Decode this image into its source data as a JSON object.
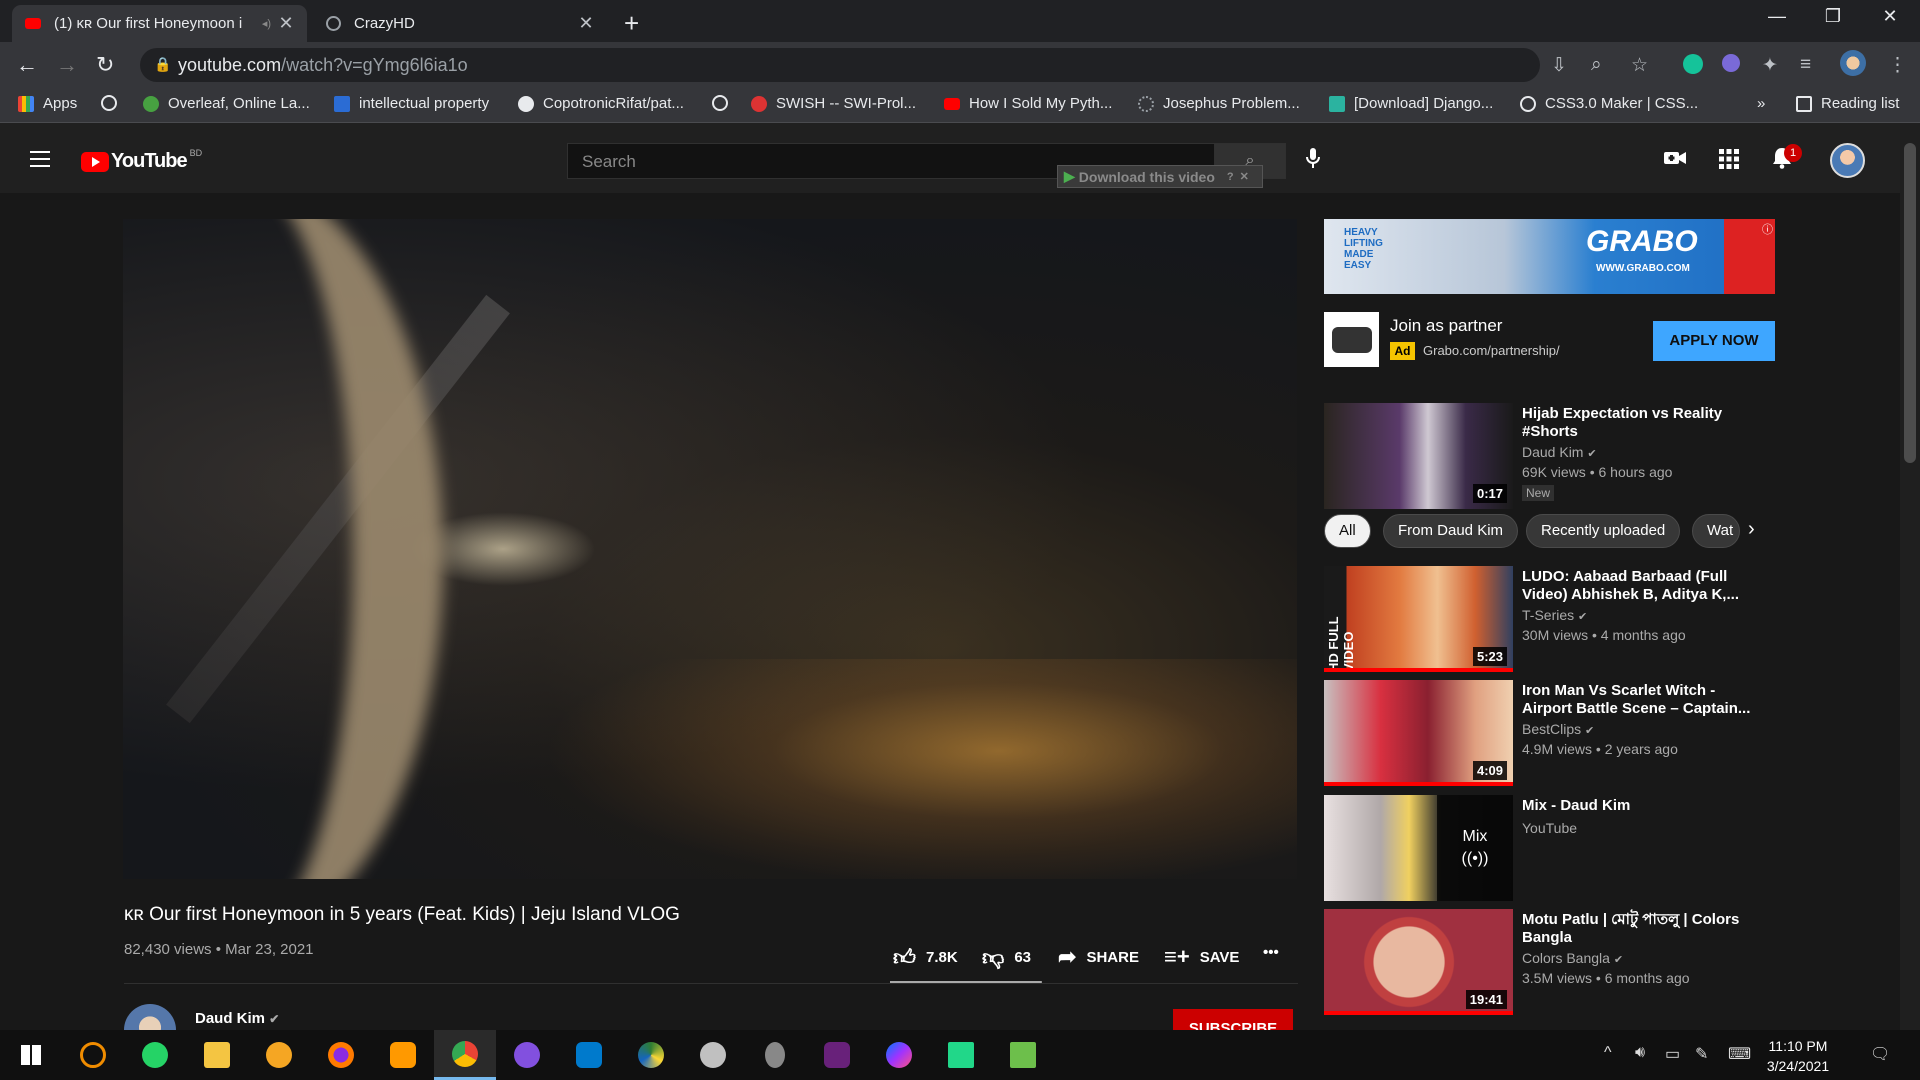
{
  "browser": {
    "tabs": [
      {
        "title": "(1) ᴋʀ Our first Honeymoon i",
        "active": true
      },
      {
        "title": "CrazyHD",
        "active": false
      }
    ],
    "url_host": "youtube.com",
    "url_path": "/watch?v=gYmg6l6ia1o",
    "bookmarks": [
      {
        "label": "Apps"
      },
      {
        "label": ""
      },
      {
        "label": "Overleaf, Online La..."
      },
      {
        "label": "intellectual property"
      },
      {
        "label": "CopotronicRifat/pat..."
      },
      {
        "label": ""
      },
      {
        "label": "SWISH -- SWI-Prol..."
      },
      {
        "label": "How I Sold My Pyth..."
      },
      {
        "label": "Josephus Problem..."
      },
      {
        "label": "[Download] Django..."
      },
      {
        "label": "CSS3.0 Maker | CSS..."
      }
    ],
    "bookmarks_overflow": "»",
    "reading_list": "Reading list"
  },
  "youtube": {
    "logo_text": "YouTube",
    "country": "BD",
    "search_placeholder": "Search",
    "download_bar": "Download this video",
    "notification_count": "1",
    "video": {
      "title": "ᴋʀ Our first Honeymoon in 5 years (Feat. Kids) | Jeju Island VLOG",
      "views": "82,430 views • Mar 23, 2021",
      "likes": "7.8K",
      "dislikes": "63",
      "like_ratio": 0.992,
      "share": "SHARE",
      "save": "SAVE",
      "more": "•••"
    },
    "channel": {
      "name": "Daud Kim",
      "subscribe": "SUBSCRIBE"
    },
    "ad": {
      "banner_brand": "GRABO",
      "banner_tagline": "HEAVY LIFTING MADE EASY",
      "banner_url": "WWW.GRABO.COM",
      "title": "Join as partner",
      "badge": "Ad",
      "url": "Grabo.com/partnership/",
      "cta": "APPLY NOW"
    },
    "chips": [
      "All",
      "From Daud Kim",
      "Recently uploaded",
      "Wat"
    ],
    "recommendations": [
      {
        "title": "Hijab Expectation vs Reality #Shorts",
        "channel": "Daud Kim",
        "verified": true,
        "meta": "69K views • 6 hours ago",
        "badge": "New",
        "duration": "0:17",
        "watched": 0
      },
      {
        "title": "LUDO: Aabaad Barbaad (Full Video) Abhishek B, Aditya K,...",
        "channel": "T-Series",
        "verified": true,
        "meta": "30M views • 4 months ago",
        "badge": "",
        "duration": "5:23",
        "watched": 1.0
      },
      {
        "title": "Iron Man Vs Scarlet Witch - Airport Battle Scene – Captain...",
        "channel": "BestClips",
        "verified": true,
        "meta": "4.9M views • 2 years ago",
        "badge": "",
        "duration": "4:09",
        "watched": 1.0
      },
      {
        "title": "Mix - Daud Kim",
        "channel": "YouTube",
        "verified": false,
        "meta": "",
        "badge": "",
        "duration": "",
        "mix_label": "Mix",
        "watched": 0
      },
      {
        "title": "Motu Patlu | মোটু পাতলু | Colors Bangla",
        "channel": "Colors Bangla",
        "verified": true,
        "meta": "3.5M views • 6 months ago",
        "badge": "",
        "duration": "19:41",
        "watched": 1.0
      }
    ]
  },
  "taskbar": {
    "time": "11:10 PM",
    "date": "3/24/2021"
  }
}
